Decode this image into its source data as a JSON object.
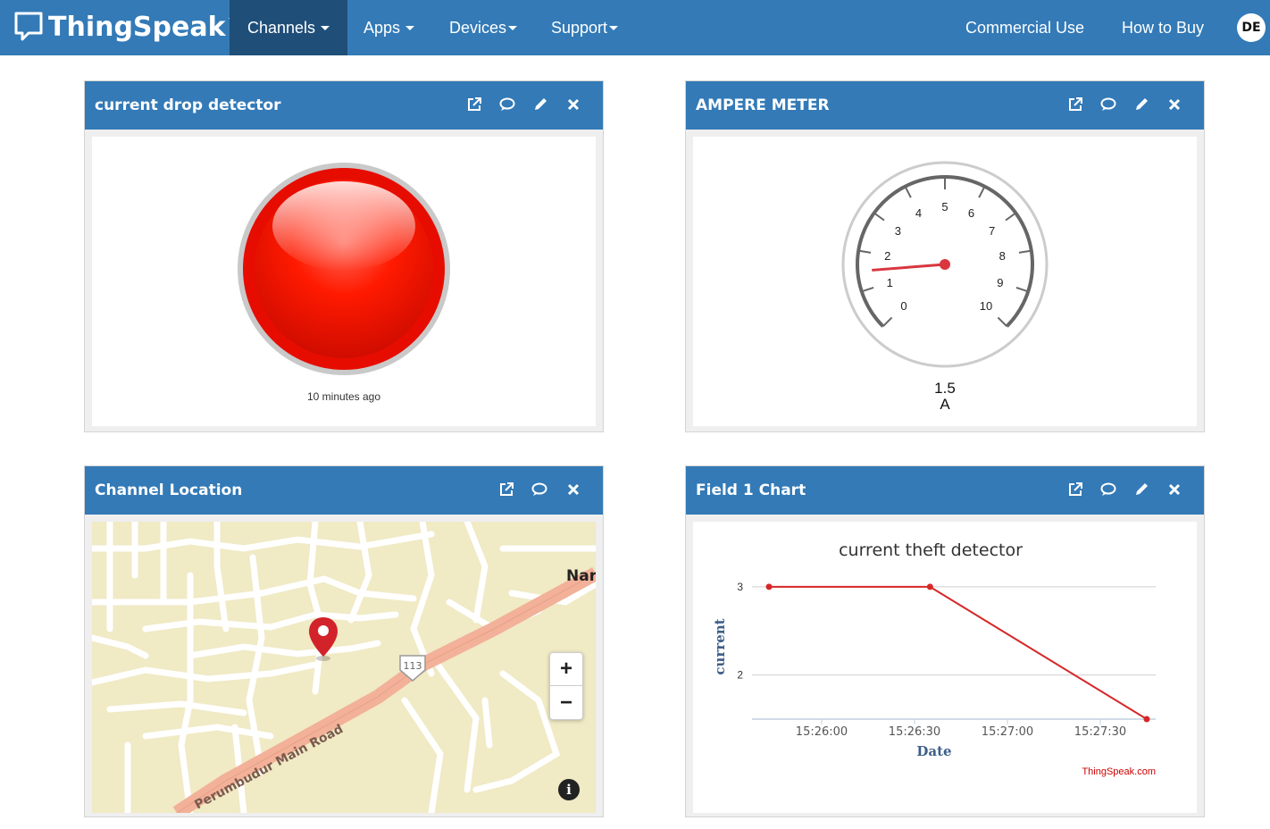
{
  "navbar": {
    "brand": "ThingSpeak",
    "brand_tm": "™",
    "items": [
      {
        "label": "Channels"
      },
      {
        "label": "Apps"
      },
      {
        "label": "Devices"
      },
      {
        "label": "Support"
      }
    ],
    "commercial_use": "Commercial Use",
    "how_to_buy": "How to Buy",
    "avatar_initials": "DE"
  },
  "widgets": {
    "lamp": {
      "title": "current drop detector",
      "status_color": "#ff1a00",
      "updated": "10 minutes ago"
    },
    "gauge": {
      "title": "AMPERE METER",
      "min": 0,
      "max": 10,
      "ticks": [
        "0",
        "1",
        "2",
        "3",
        "4",
        "5",
        "6",
        "7",
        "8",
        "9",
        "10"
      ],
      "value_numeric": 1.5,
      "value_text": "1.5",
      "unit": "A"
    },
    "location": {
      "title": "Channel Location",
      "road_label": "Perumbudur Main Road",
      "route_shield": "113",
      "place_label": "Nar",
      "zoom_in": "+",
      "zoom_out": "−",
      "info": "i"
    },
    "chart": {
      "panel_title": "Field 1 Chart",
      "credit": "ThingSpeak.com"
    }
  },
  "chart_data": {
    "type": "line",
    "title": "current theft detector",
    "xlabel": "Date",
    "ylabel": "current",
    "x_ticks": [
      "15:26:00",
      "15:26:30",
      "15:27:00",
      "15:27:30"
    ],
    "y_ticks": [
      "2",
      "3"
    ],
    "ylim": [
      1.5,
      3.1
    ],
    "series": [
      {
        "color": "#d62728",
        "points": [
          {
            "x": "15:25:43",
            "y": 3
          },
          {
            "x": "15:26:35",
            "y": 3
          },
          {
            "x": "15:27:45",
            "y": 1.5
          }
        ]
      }
    ],
    "grid": true,
    "legend": "none"
  }
}
